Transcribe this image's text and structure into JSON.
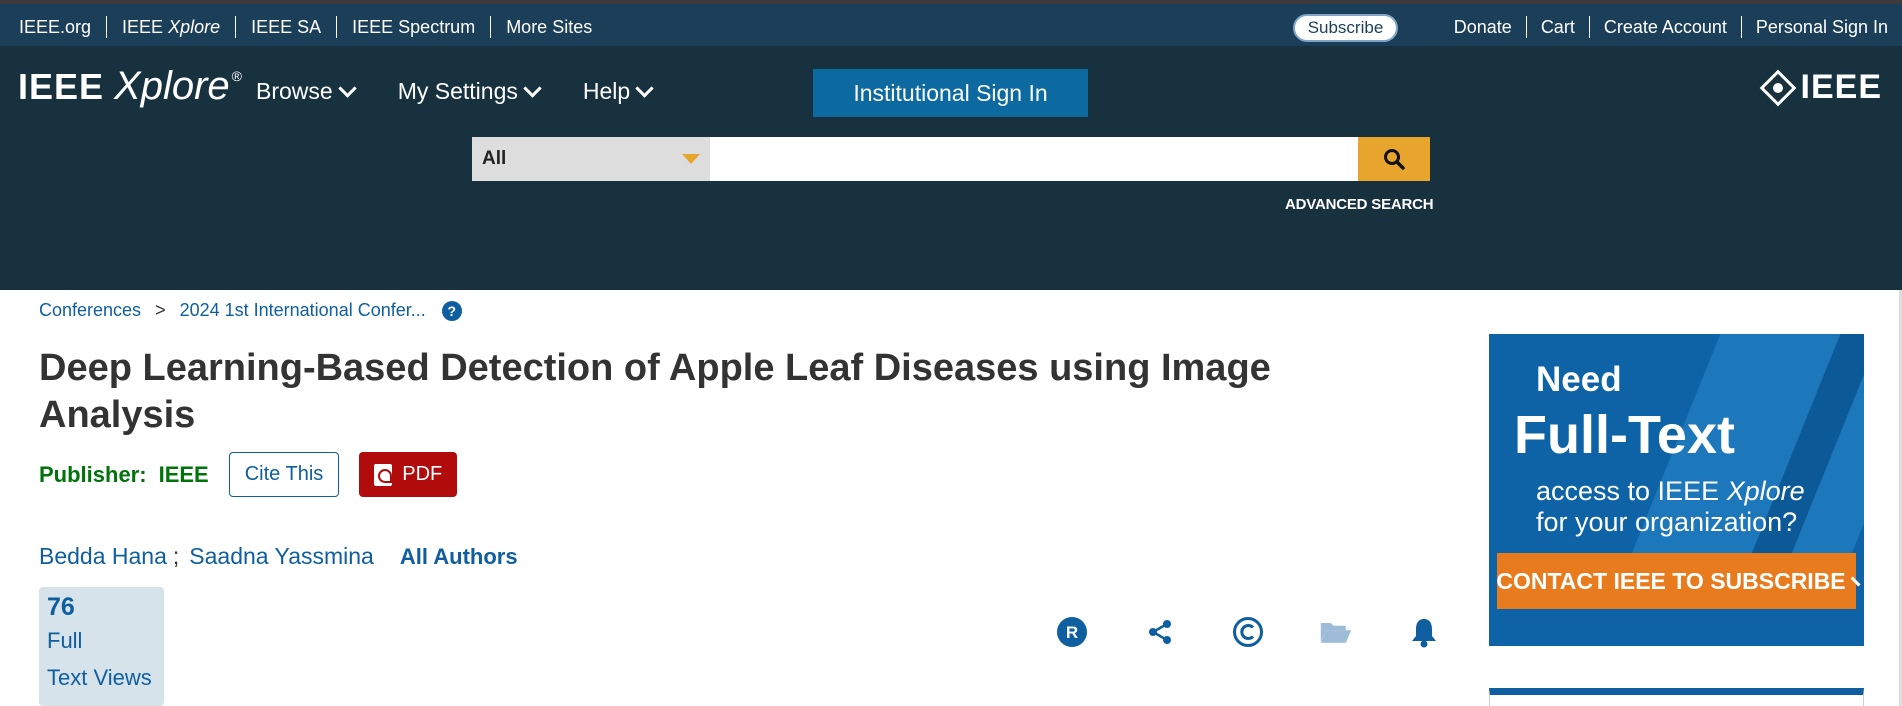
{
  "topbar": {
    "links": [
      {
        "text": "IEEE.org",
        "italic": ""
      },
      {
        "text": "IEEE ",
        "italic": "Xplore"
      },
      {
        "text": "IEEE SA",
        "italic": ""
      },
      {
        "text": "IEEE Spectrum",
        "italic": ""
      },
      {
        "text": "More Sites",
        "italic": ""
      }
    ],
    "subscribe": "Subscribe",
    "right_links": [
      "Donate",
      "Cart",
      "Create Account",
      "Personal Sign In"
    ]
  },
  "header": {
    "logo_ieee": "IEEE",
    "logo_xplore": "Xplore",
    "logo_reg": "®",
    "nav": [
      "Browse",
      "My Settings",
      "Help"
    ],
    "institutional_signin": "Institutional Sign In",
    "brand_word": "IEEE"
  },
  "search": {
    "scope": "All",
    "placeholder": "",
    "advanced": "ADVANCED SEARCH"
  },
  "breadcrumb": {
    "items": [
      "Conferences",
      "2024 1st International Confer..."
    ],
    "separator": ">",
    "help": "?"
  },
  "article": {
    "title": "Deep Learning-Based Detection of Apple Leaf Diseases using Image Analysis",
    "publisher_label": "Publisher:",
    "publisher_value": "IEEE",
    "cite_label": "Cite This",
    "pdf_label": "PDF",
    "authors": [
      "Bedda Hana",
      "Saadna Yassmina"
    ],
    "author_sep": ";",
    "all_authors": "All Authors"
  },
  "metrics": {
    "count": "76",
    "label_line1": "Full",
    "label_line2": "Text Views"
  },
  "actions": [
    {
      "icon": "rights-icon"
    },
    {
      "icon": "share-icon"
    },
    {
      "icon": "copyright-icon"
    },
    {
      "icon": "folder-icon"
    },
    {
      "icon": "bell-icon"
    }
  ],
  "ad": {
    "need": "Need",
    "full_text": "Full-Text",
    "access_line1_prefix": "access to IEEE ",
    "access_line1_italic": "Xplore",
    "access_line2": "for your organization?",
    "cta": "CONTACT IEEE TO SUBSCRIBE"
  },
  "colors": {
    "topbar": "#1b3f58",
    "header": "#17313f",
    "accent_blue": "#0c6aa0",
    "search_button": "#e7a52e",
    "publisher_green": "#00730b",
    "pdf_red": "#b10b0b",
    "ad_blue": "#0e63a6",
    "ad_orange": "#e87b1d"
  }
}
